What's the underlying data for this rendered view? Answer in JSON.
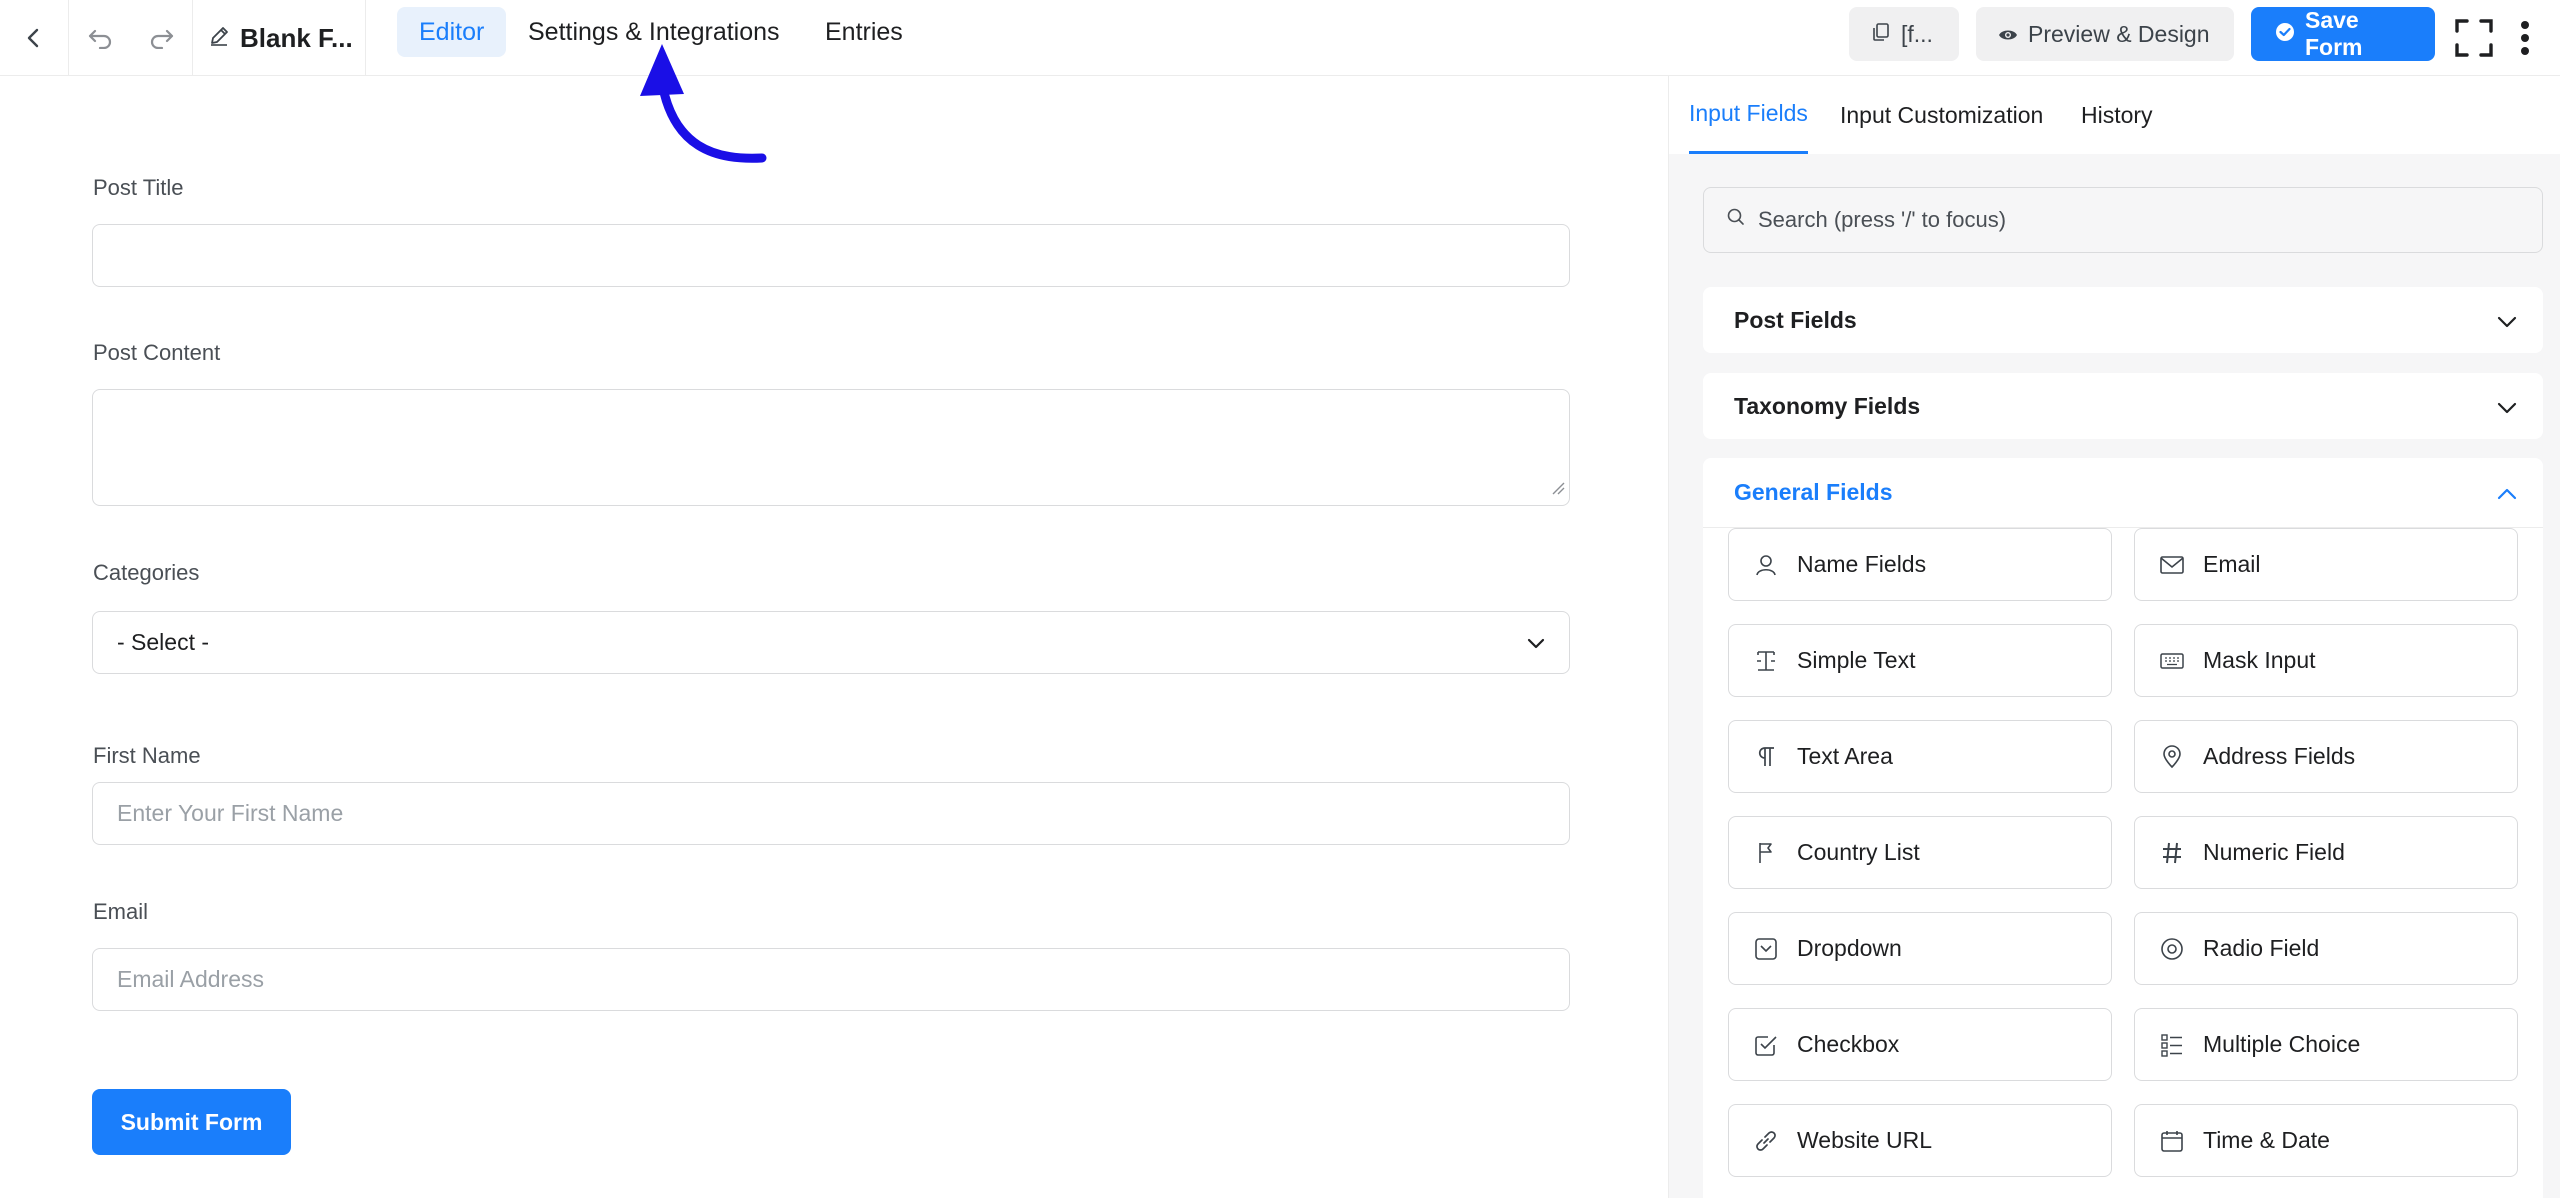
{
  "topbar": {
    "form_name": "Blank F...",
    "tabs": [
      {
        "label": "Editor",
        "active": true
      },
      {
        "label": "Settings & Integrations",
        "active": false
      },
      {
        "label": "Entries",
        "active": false
      }
    ],
    "shortcode_label": "[f...",
    "preview_label": "Preview & Design",
    "save_label": "Save Form"
  },
  "form": {
    "post_title_label": "Post Title",
    "post_content_label": "Post Content",
    "categories_label": "Categories",
    "categories_value": "- Select -",
    "first_name_label": "First Name",
    "first_name_placeholder": "Enter Your First Name",
    "email_label": "Email",
    "email_placeholder": "Email Address",
    "submit_label": "Submit Form"
  },
  "sidebar": {
    "tabs": [
      {
        "label": "Input Fields",
        "active": true
      },
      {
        "label": "Input Customization",
        "active": false
      },
      {
        "label": "History",
        "active": false
      }
    ],
    "search_placeholder": "Search (press '/' to focus)",
    "sections": [
      {
        "label": "Post Fields",
        "open": false
      },
      {
        "label": "Taxonomy Fields",
        "open": false
      },
      {
        "label": "General Fields",
        "open": true
      }
    ],
    "general_fields": [
      {
        "label": "Name Fields",
        "icon": "user-icon"
      },
      {
        "label": "Email",
        "icon": "envelope-icon"
      },
      {
        "label": "Simple Text",
        "icon": "text-cursor-icon"
      },
      {
        "label": "Mask Input",
        "icon": "keyboard-icon"
      },
      {
        "label": "Text Area",
        "icon": "paragraph-icon"
      },
      {
        "label": "Address Fields",
        "icon": "map-pin-icon"
      },
      {
        "label": "Country List",
        "icon": "flag-icon"
      },
      {
        "label": "Numeric Field",
        "icon": "hash-icon"
      },
      {
        "label": "Dropdown",
        "icon": "dropdown-icon"
      },
      {
        "label": "Radio Field",
        "icon": "radio-icon"
      },
      {
        "label": "Checkbox",
        "icon": "checkbox-icon"
      },
      {
        "label": "Multiple Choice",
        "icon": "list-icon"
      },
      {
        "label": "Website URL",
        "icon": "link-icon"
      },
      {
        "label": "Time & Date",
        "icon": "calendar-icon"
      }
    ]
  },
  "colors": {
    "accent": "#1a7efb",
    "annotation_arrow": "#1a0fe6"
  }
}
